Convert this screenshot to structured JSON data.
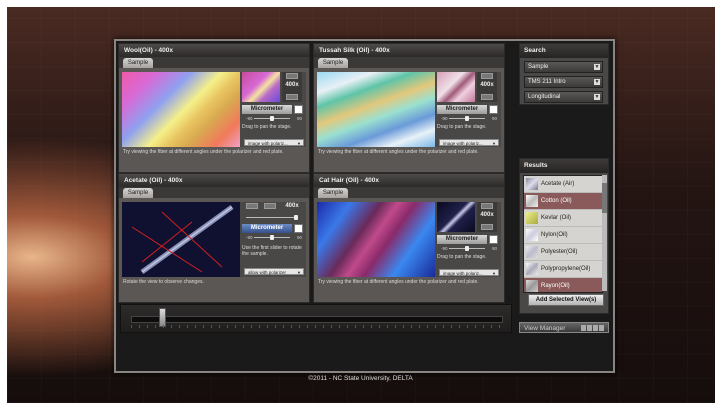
{
  "panels": [
    {
      "title": "Wool(Oil) - 400x",
      "tab": "Sample",
      "zoom": "400x",
      "micrometer": "Micrometer",
      "scale_left": "-90",
      "scale_right": "90",
      "hint": "Drag to pan the stage.",
      "select": "image with polariz...",
      "footer": "Try viewing the fiber at different angles under the polarizer and red plate.",
      "min": "–",
      "close": "✕"
    },
    {
      "title": "Tussah Silk (Oil) - 400x",
      "tab": "Sample",
      "zoom": "400x",
      "micrometer": "Micrometer",
      "scale_left": "-90",
      "scale_right": "90",
      "hint": "Drag to pan the stage.",
      "select": "image with polariz...",
      "footer": "Try viewing the fiber at different angles under the polarizer and red plate.",
      "min": "–",
      "close": "✕"
    },
    {
      "title": "Acetate (Oil) - 400x",
      "tab": "Sample",
      "zoom": "400x",
      "micrometer": "Micrometer",
      "scale_left": "-90",
      "scale_right": "90",
      "hint": "Use the first slider to rotate the sample.",
      "select": "allow with polarizer",
      "footer": "Rotate the view to observe changes.",
      "min": "–",
      "close": "✕"
    },
    {
      "title": "Cat Hair (Oil) - 400x",
      "tab": "Sample",
      "zoom": "400x",
      "micrometer": "Micrometer",
      "scale_left": "-90",
      "scale_right": "90",
      "hint": "Drag to pan the stage.",
      "select": "image with polariz...",
      "footer": "Try viewing the fiber at different angles under the polarizer and red plate.",
      "min": "–",
      "close": "✕"
    }
  ],
  "search": {
    "title": "Search",
    "dropdowns": [
      "Sample",
      "TMS 211 Intro",
      "Longitudinal"
    ]
  },
  "results": {
    "title": "Results",
    "items": [
      "Acetate (Air)",
      "Cotton (Oil)",
      "Kevlar (Oil)",
      "Nylon(Oil)",
      "Polyester(Oil)",
      "Polypropylene(Oil)",
      "Rayon(Oil)"
    ],
    "selected": [
      "Cotton (Oil)",
      "Rayon(Oil)"
    ],
    "add_button": "Add Selected View(s)"
  },
  "view_manager": "View Manager",
  "copyright": "©2011 - NC State University, DELTA"
}
